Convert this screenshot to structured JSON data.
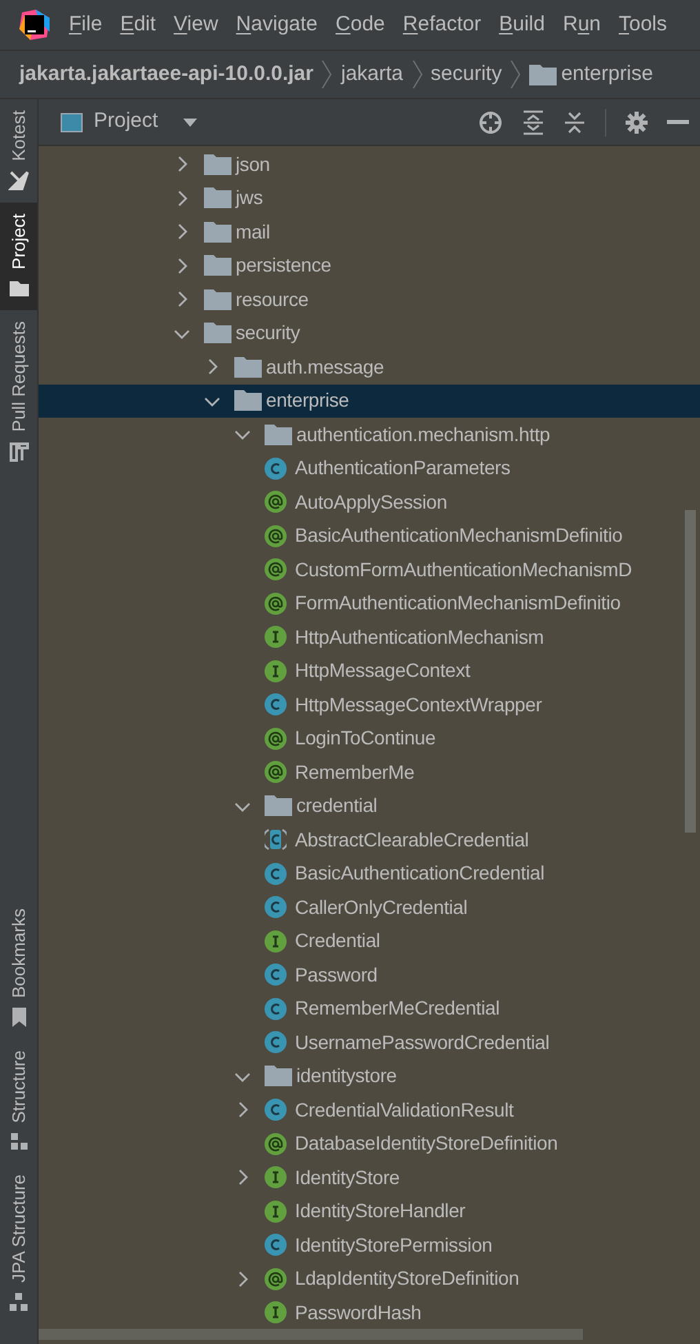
{
  "menu_bar": {
    "items": [
      {
        "mnemonic": "F",
        "after": "ile"
      },
      {
        "mnemonic": "E",
        "after": "dit"
      },
      {
        "mnemonic": "V",
        "after": "iew"
      },
      {
        "mnemonic": "N",
        "after": "avigate"
      },
      {
        "mnemonic": "C",
        "after": "ode"
      },
      {
        "mnemonic": "R",
        "after": "efactor"
      },
      {
        "mnemonic": "B",
        "after": "uild"
      },
      {
        "before": "R",
        "mnemonic": "u",
        "after": "n"
      },
      {
        "mnemonic": "T",
        "after": "ools"
      }
    ]
  },
  "breadcrumb": [
    {
      "label": "jakarta.jakartaee-api-10.0.0.jar",
      "kind": "jar"
    },
    {
      "label": "jakarta",
      "kind": "package"
    },
    {
      "label": "security",
      "kind": "package"
    },
    {
      "label": "enterprise",
      "kind": "folder"
    }
  ],
  "tool_strip": {
    "top": [
      {
        "label": "Kotest",
        "selected": false
      },
      {
        "label": "Project",
        "selected": true
      },
      {
        "label": "Pull Requests",
        "selected": false
      }
    ],
    "bottom": [
      {
        "label": "Bookmarks",
        "selected": false
      },
      {
        "label": "Structure",
        "selected": false
      },
      {
        "label": "JPA Structure",
        "selected": false
      }
    ]
  },
  "panel": {
    "title": "Project"
  },
  "tree": [
    {
      "label": "json",
      "kind": "folder",
      "expanded": false,
      "selected": false
    },
    {
      "label": "jws",
      "kind": "folder",
      "expanded": false,
      "selected": false
    },
    {
      "label": "mail",
      "kind": "folder",
      "expanded": false,
      "selected": false
    },
    {
      "label": "persistence",
      "kind": "folder",
      "expanded": false,
      "selected": false
    },
    {
      "label": "resource",
      "kind": "folder",
      "expanded": false,
      "selected": false
    },
    {
      "label": "security",
      "kind": "folder",
      "expanded": true,
      "selected": false,
      "children": [
        {
          "label": "auth.message",
          "kind": "folder",
          "expanded": false,
          "selected": false
        },
        {
          "label": "enterprise",
          "kind": "folder",
          "expanded": true,
          "selected": true,
          "children": [
            {
              "label": "authentication.mechanism.http",
              "kind": "folder",
              "expanded": true,
              "selected": false,
              "children": [
                {
                  "label": "AuthenticationParameters",
                  "kind": "class",
                  "selected": false
                },
                {
                  "label": "AutoApplySession",
                  "kind": "annotation",
                  "selected": false
                },
                {
                  "label": "BasicAuthenticationMechanismDefinitio",
                  "kind": "annotation",
                  "selected": false
                },
                {
                  "label": "CustomFormAuthenticationMechanismD",
                  "kind": "annotation",
                  "selected": false
                },
                {
                  "label": "FormAuthenticationMechanismDefinitio",
                  "kind": "annotation",
                  "selected": false
                },
                {
                  "label": "HttpAuthenticationMechanism",
                  "kind": "interface",
                  "selected": false
                },
                {
                  "label": "HttpMessageContext",
                  "kind": "interface",
                  "selected": false
                },
                {
                  "label": "HttpMessageContextWrapper",
                  "kind": "class",
                  "selected": false
                },
                {
                  "label": "LoginToContinue",
                  "kind": "annotation",
                  "selected": false
                },
                {
                  "label": "RememberMe",
                  "kind": "annotation",
                  "selected": false
                }
              ]
            },
            {
              "label": "credential",
              "kind": "folder",
              "expanded": true,
              "selected": false,
              "children": [
                {
                  "label": "AbstractClearableCredential",
                  "kind": "abstract",
                  "selected": false
                },
                {
                  "label": "BasicAuthenticationCredential",
                  "kind": "class",
                  "selected": false
                },
                {
                  "label": "CallerOnlyCredential",
                  "kind": "class",
                  "selected": false
                },
                {
                  "label": "Credential",
                  "kind": "interface",
                  "selected": false
                },
                {
                  "label": "Password",
                  "kind": "class",
                  "selected": false
                },
                {
                  "label": "RememberMeCredential",
                  "kind": "class",
                  "selected": false
                },
                {
                  "label": "UsernamePasswordCredential",
                  "kind": "class",
                  "selected": false
                }
              ]
            },
            {
              "label": "identitystore",
              "kind": "folder",
              "expanded": true,
              "selected": false,
              "children": [
                {
                  "label": "CredentialValidationResult",
                  "kind": "class",
                  "expanded": false,
                  "selected": false
                },
                {
                  "label": "DatabaseIdentityStoreDefinition",
                  "kind": "annotation",
                  "selected": false
                },
                {
                  "label": "IdentityStore",
                  "kind": "interface",
                  "expanded": false,
                  "selected": false
                },
                {
                  "label": "IdentityStoreHandler",
                  "kind": "interface",
                  "selected": false
                },
                {
                  "label": "IdentityStorePermission",
                  "kind": "class",
                  "selected": false
                },
                {
                  "label": "LdapIdentityStoreDefinition",
                  "kind": "annotation",
                  "expanded": false,
                  "selected": false
                },
                {
                  "label": "PasswordHash",
                  "kind": "interface",
                  "selected": false
                }
              ]
            }
          ]
        }
      ]
    }
  ]
}
